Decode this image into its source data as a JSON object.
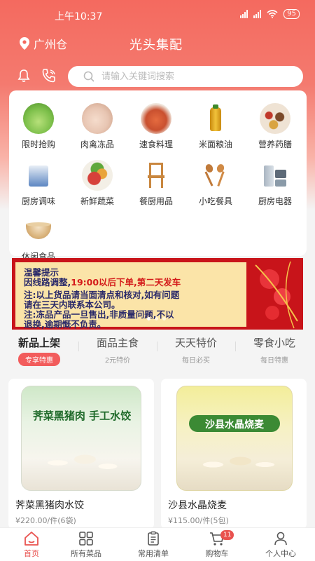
{
  "status_bar": {
    "time": "上午10:37",
    "battery": "95"
  },
  "header": {
    "location": "广州仓",
    "title": "光头集配"
  },
  "search": {
    "placeholder": "请输入关键词搜索"
  },
  "categories": [
    {
      "label": "限时抢购",
      "icon": "cabbage-icon",
      "color": "#7cbf4a"
    },
    {
      "label": "肉禽冻品",
      "icon": "meat-icon",
      "color": "#e8c6b3"
    },
    {
      "label": "速食料理",
      "icon": "dish-icon",
      "color": "#c9502f"
    },
    {
      "label": "米面粮油",
      "icon": "oil-bottle-icon",
      "color": "#d9a520"
    },
    {
      "label": "营养药膳",
      "icon": "herbs-icon",
      "color": "#9b5a3a"
    },
    {
      "label": "厨房调味",
      "icon": "seasoning-icon",
      "color": "#5c86c2"
    },
    {
      "label": "新鲜蔬菜",
      "icon": "vegetables-icon",
      "color": "#d6413a"
    },
    {
      "label": "餐厨用品",
      "icon": "chair-icon",
      "color": "#c9873f"
    },
    {
      "label": "小吃餐具",
      "icon": "utensils-icon",
      "color": "#c07a3a"
    },
    {
      "label": "厨房电器",
      "icon": "appliances-icon",
      "color": "#8a9aa8"
    },
    {
      "label": "休闲食品",
      "icon": "soup-bowl-icon",
      "color": "#d9b27a"
    }
  ],
  "banner": {
    "line1": "温馨提示",
    "line2_prefix": "因线路调整,",
    "line2_red": "19:00以后下单,第二天发车",
    "line3": "注:以上货品请当面清点和核对,如有问题",
    "line4": "请在三天内联系本公司。",
    "line5": "注:冻品产品一旦售出,非质量问题,不以",
    "line6": "退换,逾期慨不负责。"
  },
  "tabs": [
    {
      "title": "新品上架",
      "subtitle": "专享特惠"
    },
    {
      "title": "面品主食",
      "subtitle": "2元特价"
    },
    {
      "title": "天天特价",
      "subtitle": "每日必买"
    },
    {
      "title": "零食小吃",
      "subtitle": "每日特惠"
    }
  ],
  "products": [
    {
      "name": "荠菜黑猪肉水饺",
      "price": "¥220.00/件(6袋)",
      "package_text": "荠菜黑猪肉 手工水饺"
    },
    {
      "name": "沙县水晶烧麦",
      "price": "¥115.00/件(5包)",
      "package_text": "沙县水晶烧麦"
    }
  ],
  "bottom_nav": [
    {
      "label": "首页"
    },
    {
      "label": "所有菜品"
    },
    {
      "label": "常用清单"
    },
    {
      "label": "购物车",
      "badge": "11"
    },
    {
      "label": "个人中心"
    }
  ],
  "colors": {
    "brand": "#f46a5f",
    "accent": "#e9524f"
  }
}
